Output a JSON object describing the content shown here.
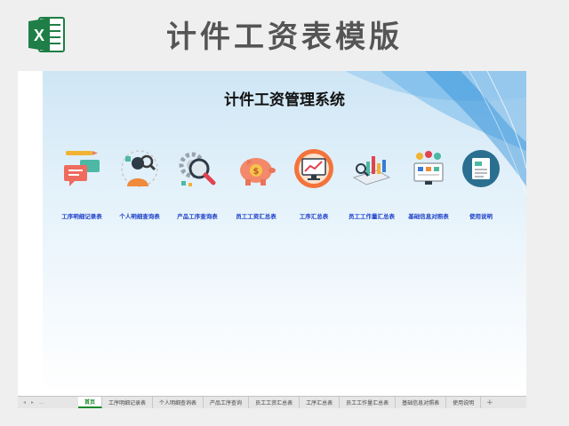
{
  "banner": {
    "title": "计件工资表模版",
    "logo": "excel-icon",
    "logo_letter": "X"
  },
  "system": {
    "title": "计件工资管理系统"
  },
  "modules": [
    {
      "label": "工序明细记录表",
      "icon": "chat-pencil-icon"
    },
    {
      "label": "个人明细查询表",
      "icon": "person-search-icon"
    },
    {
      "label": "产品工序查询表",
      "icon": "gear-magnifier-icon"
    },
    {
      "label": "员工工资汇总表",
      "icon": "piggy-bank-icon"
    },
    {
      "label": "工序汇总表",
      "icon": "monitor-chart-icon"
    },
    {
      "label": "员工工作量汇总表",
      "icon": "bar-chart-icon"
    },
    {
      "label": "基础信息对照表",
      "icon": "team-board-icon"
    },
    {
      "label": "使用说明",
      "icon": "document-icon"
    }
  ],
  "tabs": {
    "nav": [
      "◂",
      "▸",
      "…"
    ],
    "items": [
      "首页",
      "工序明细记录表",
      "个人明细查询表",
      "产品工序查询",
      "员工工资汇总表",
      "工序汇总表",
      "员工工作量汇总表",
      "基础信息对照表",
      "使用说明"
    ],
    "active_index": 0,
    "add_label": "+"
  },
  "colors": {
    "excel_green": "#1e7e45",
    "module_label": "#1e40c8",
    "canvas_top": "#cfe6f5"
  }
}
